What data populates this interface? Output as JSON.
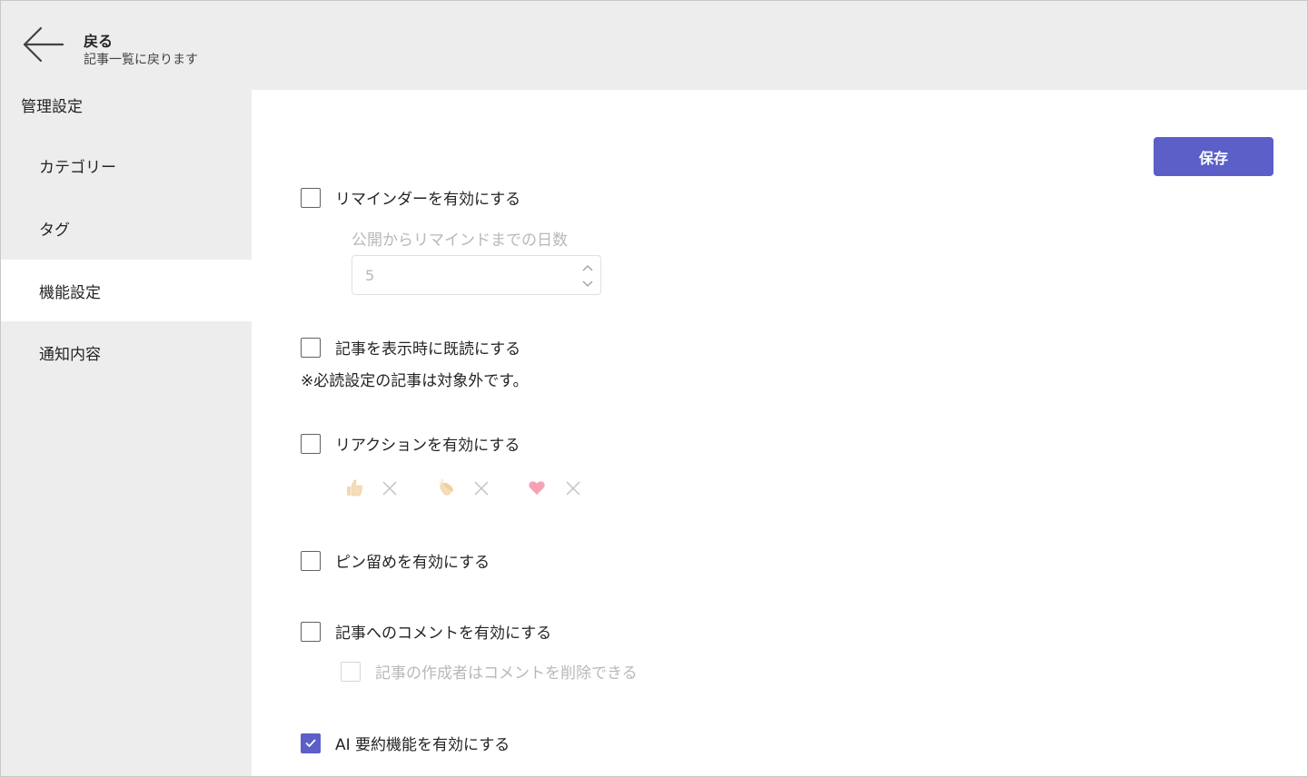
{
  "header": {
    "back_title": "戻る",
    "back_subtitle": "記事一覧に戻ります"
  },
  "sidebar": {
    "title": "管理設定",
    "items": [
      {
        "label": "カテゴリー",
        "active": false
      },
      {
        "label": "タグ",
        "active": false
      },
      {
        "label": "機能設定",
        "active": true
      },
      {
        "label": "通知内容",
        "active": false
      }
    ]
  },
  "main": {
    "save_label": "保存",
    "reminder": {
      "label": "リマインダーを有効にする",
      "checked": false,
      "days_label": "公開からリマインドまでの日数",
      "days_value": "5"
    },
    "mark_read": {
      "label": "記事を表示時に既読にする",
      "checked": false,
      "note": "※必読設定の記事は対象外です。"
    },
    "reactions": {
      "label": "リアクションを有効にする",
      "checked": false,
      "items": [
        "thumbs-up",
        "clapping-hands",
        "heart"
      ]
    },
    "pin": {
      "label": "ピン留めを有効にする",
      "checked": false
    },
    "comments": {
      "label": "記事へのコメントを有効にする",
      "checked": false,
      "author_delete_label": "記事の作成者はコメントを削除できる",
      "author_delete_checked": false
    },
    "ai_summary": {
      "label": "AI 要約機能を有効にする",
      "checked": true
    }
  },
  "colors": {
    "accent": "#5b5fc7",
    "sidebar_bg": "#ededed",
    "disabled_text": "#b8b8b8"
  }
}
